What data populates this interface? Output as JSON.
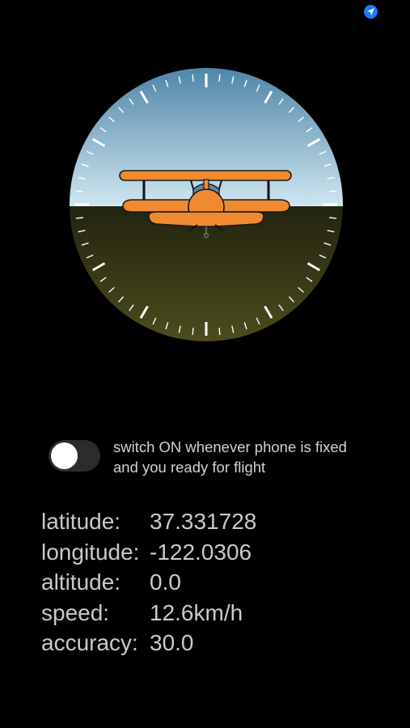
{
  "status_bar": {
    "location_icon": "location-arrow-icon",
    "location_color": "#1a7cf5"
  },
  "instrument": {
    "icon": "biplane-icon",
    "sky_color_top": "#4f86a8",
    "sky_color_horizon": "#cde4ef",
    "ground_color_top": "#26280f",
    "ground_color_bottom": "#4a4a1c",
    "plane_color": "#f08a30"
  },
  "toggle": {
    "state": "off",
    "label": "switch ON whenever phone is fixed and you ready for flight"
  },
  "readouts": {
    "latitude_label": "latitude:",
    "latitude_value": "37.331728",
    "longitude_label": "longitude:",
    "longitude_value": "-122.0306",
    "altitude_label": "altitude:",
    "altitude_value": "0.0",
    "speed_label": "speed:",
    "speed_value": "12.6km/h",
    "accuracy_label": "accuracy:",
    "accuracy_value": "30.0"
  }
}
